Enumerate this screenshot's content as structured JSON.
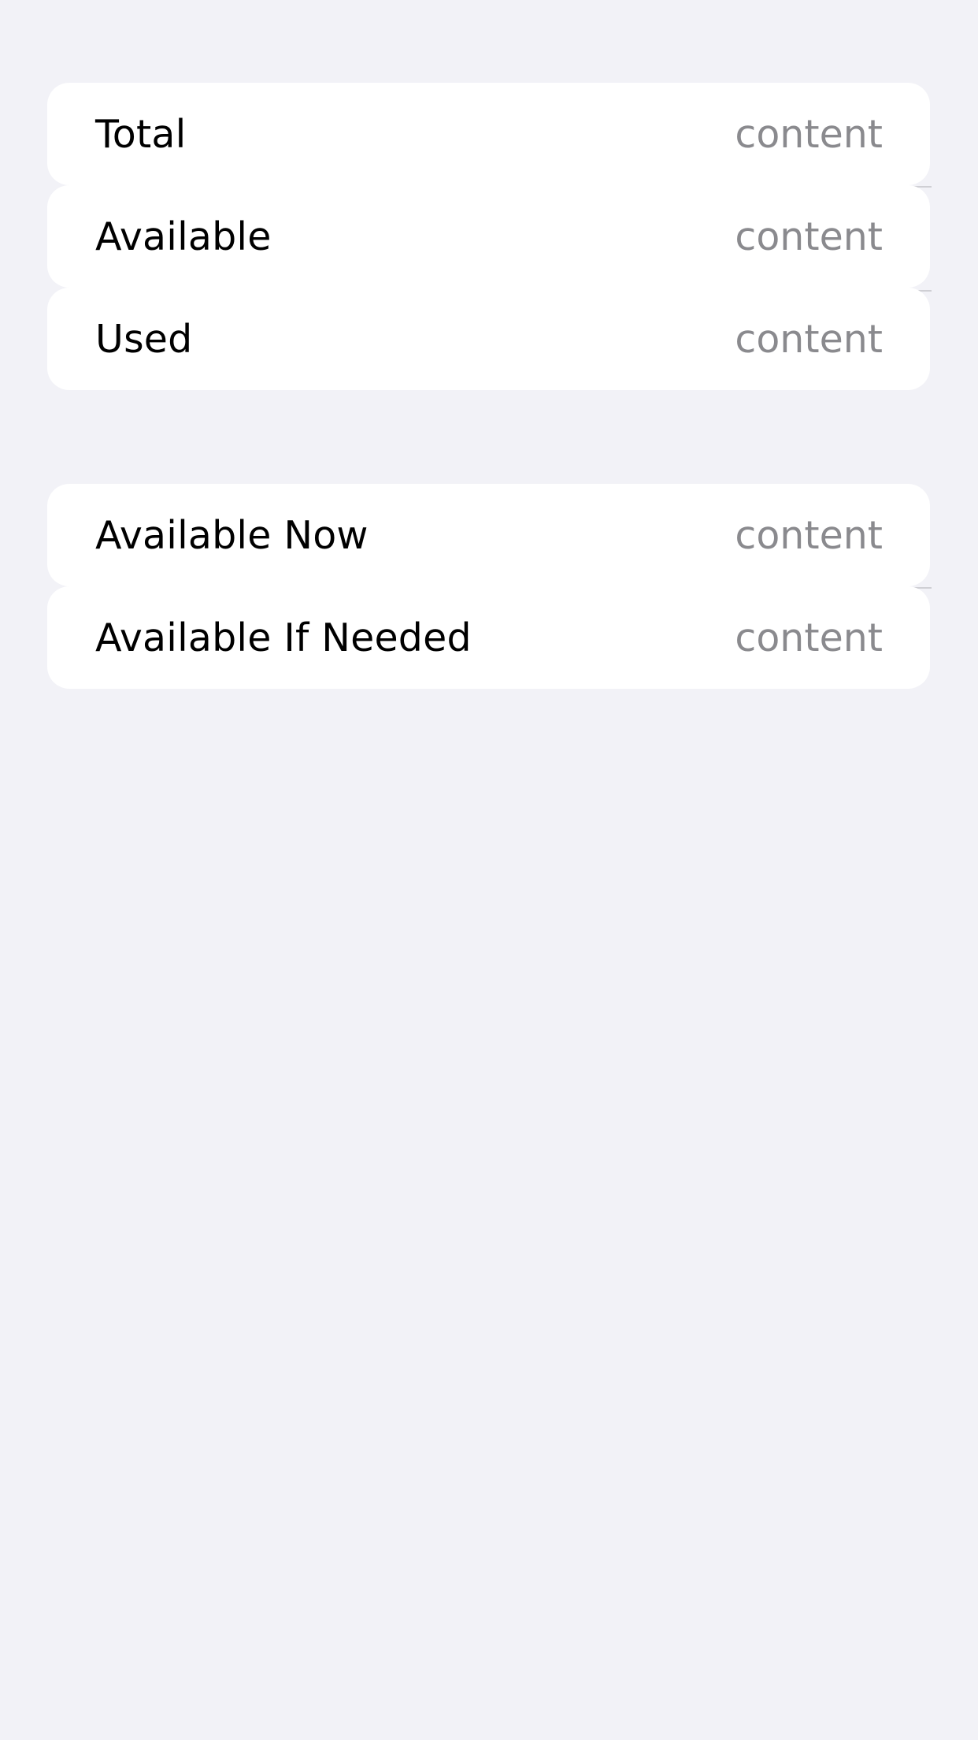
{
  "colors": {
    "background": "#f2f2f7",
    "cell": "#ffffff",
    "label": "#000000",
    "value": "#8a8a8e",
    "separator": "#cfcfd4"
  },
  "sections": [
    {
      "rows": [
        {
          "label": "Total",
          "value": "content"
        },
        {
          "label": "Available",
          "value": "content"
        },
        {
          "label": "Used",
          "value": "content"
        }
      ]
    },
    {
      "rows": [
        {
          "label": "Available Now",
          "value": "content"
        },
        {
          "label": "Available If Needed",
          "value": "content"
        }
      ]
    }
  ]
}
